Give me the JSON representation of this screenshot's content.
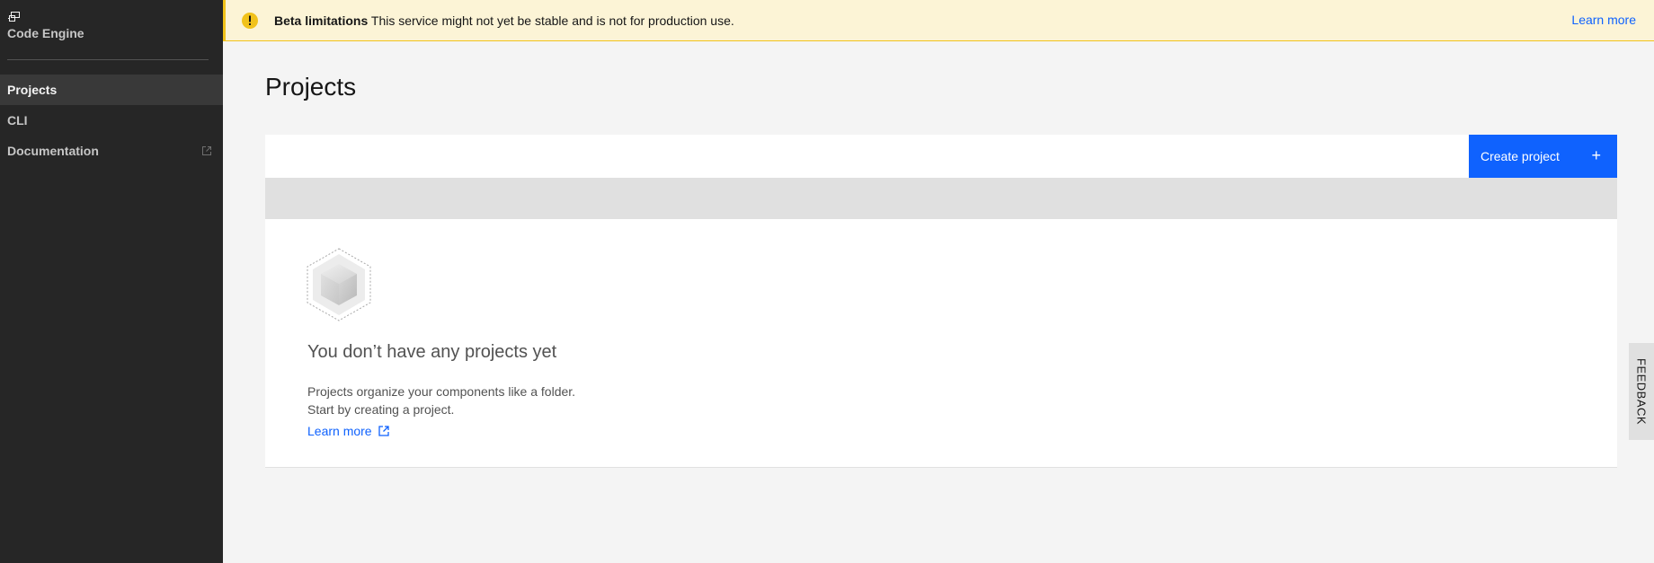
{
  "sidebar": {
    "brand_title": "Code Engine",
    "items": [
      {
        "label": "Projects",
        "active": true
      },
      {
        "label": "CLI"
      },
      {
        "label": "Documentation",
        "icon": "external-link-icon"
      }
    ]
  },
  "banner": {
    "icon": "warning-icon",
    "title": "Beta limitations",
    "message": "This service might not yet be stable and is not for production use.",
    "link": "Learn more"
  },
  "main": {
    "title": "Projects",
    "create_button": "Create project",
    "create_icon": "+",
    "empty_state": {
      "icon": "cube-icon",
      "title": "You don’t have any projects yet",
      "line1": "Projects organize your components like a folder.",
      "line2": "Start by creating a project.",
      "link": "Learn more"
    }
  },
  "feedback": "FEEDBACK",
  "colors": {
    "sidebar_bg": "#262626",
    "accent": "#0f62fe",
    "warning": "#f1c21b",
    "banner_bg": "#fcf4d6",
    "page_bg": "#f4f4f4"
  }
}
